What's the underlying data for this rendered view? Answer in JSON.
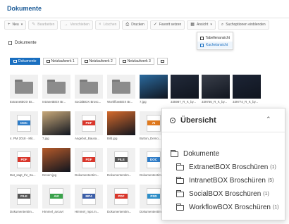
{
  "window": {
    "title": "Dokumente"
  },
  "toolbar": {
    "items": [
      {
        "label": "Neu",
        "icon": "plus-icon",
        "disabled": false,
        "caret": true
      },
      {
        "label": "Bearbeiten",
        "icon": "pencil-icon",
        "disabled": true,
        "caret": false
      },
      {
        "label": "Verschieben",
        "icon": "arrow-icon",
        "disabled": true,
        "caret": false
      },
      {
        "label": "Löschen",
        "icon": "close-icon",
        "disabled": true,
        "caret": false
      },
      {
        "label": "Drucken",
        "icon": "print-icon",
        "disabled": false,
        "caret": false
      },
      {
        "label": "Favorit setzen",
        "icon": "check-icon",
        "disabled": false,
        "caret": false
      },
      {
        "label": "Ansicht",
        "icon": "grid-icon",
        "disabled": false,
        "caret": true
      },
      {
        "label": "Suchoptionen einblenden",
        "icon": "search-icon",
        "disabled": false,
        "caret": false
      }
    ]
  },
  "view_menu": {
    "items": [
      {
        "label": "Tabellenansicht",
        "active": false
      },
      {
        "label": "Kachelansicht",
        "active": true
      }
    ]
  },
  "breadcrumb": {
    "label": "Dokumente"
  },
  "tabs": [
    {
      "label": "Dokumente",
      "active": true
    },
    {
      "label": "Netzlaufwerk 1",
      "active": false
    },
    {
      "label": "Netzlaufwerk 2",
      "active": false
    },
    {
      "label": "Netzlaufwerk 3",
      "active": false
    },
    {
      "label": "",
      "active": false
    }
  ],
  "tiles": [
    {
      "label": "ExtranetBOX Br...",
      "kind": "folder"
    },
    {
      "label": "IntranetBOX Br...",
      "kind": "folder"
    },
    {
      "label": "SocialBOX Brosc...",
      "kind": "folder"
    },
    {
      "label": "WorkflowBOX Br...",
      "kind": "folder"
    },
    {
      "label": "7.jpg",
      "kind": "photo",
      "color": "#2b6a9e"
    },
    {
      "label": "335987_R_K_by...",
      "kind": "photo",
      "color": "#222a3a"
    },
    {
      "label": "339766_R_K_by...",
      "kind": "photo",
      "color": "#3a3f4a"
    },
    {
      "label": "339774_R_K_by...",
      "kind": "photo",
      "color": "#1d2536"
    },
    {
      "label": "4. PM 2018 - Mit...",
      "kind": "file",
      "badge": "DOC",
      "color": "#2f7dc8"
    },
    {
      "label": "7.jpg",
      "kind": "photo",
      "color": "#c8a97a"
    },
    {
      "label": "Angebot_Bausa...",
      "kind": "file",
      "badge": "PDF",
      "color": "#d9362b"
    },
    {
      "label": "Bild.jpg",
      "kind": "photo",
      "color": "#d56a2c"
    },
    {
      "label": "Button_Demo...",
      "kind": "file",
      "badge": "AI",
      "color": "#e07a1f"
    },
    {
      "label": "Dat_sagt_Ihr_Su...",
      "kind": "file",
      "badge": "PDF",
      "color": "#d9362b"
    },
    {
      "label": "Desert.jpg",
      "kind": "photo",
      "color": "#b55a2a"
    },
    {
      "label": "Dokumententim...",
      "kind": "file",
      "badge": "PDF",
      "color": "#d9362b"
    },
    {
      "label": "Dokumententim...",
      "kind": "file",
      "badge": "FILE",
      "color": "#555555"
    },
    {
      "label": "Dokumententim...",
      "kind": "file",
      "badge": "DOC",
      "color": "#2f7dc8"
    },
    {
      "label": "Dokumententim...",
      "kind": "file",
      "badge": "FILE",
      "color": "#555555"
    },
    {
      "label": "Himmel_avi.avi",
      "kind": "file",
      "badge": "AVI",
      "color": "#3aa24b"
    },
    {
      "label": "Himmel_mp4.m...",
      "kind": "file",
      "badge": "MP4",
      "color": "#3b5ea8"
    },
    {
      "label": "Dokumententim...",
      "kind": "file",
      "badge": "PDF",
      "color": "#d9362b"
    },
    {
      "label": "Dokumententim...",
      "kind": "file",
      "badge": "PSD",
      "color": "#2e8fc9"
    }
  ],
  "panel": {
    "title": "Übersicht",
    "root": "Dokumente",
    "children": [
      {
        "label": "ExtranetBOX Broschüren",
        "count": "(1)"
      },
      {
        "label": "IntranetBOX Broschüren",
        "count": "(5)"
      },
      {
        "label": "SocialBOX Broschüren",
        "count": "(1)"
      },
      {
        "label": "WorkflowBOX Broschüren",
        "count": "(1)"
      }
    ]
  }
}
